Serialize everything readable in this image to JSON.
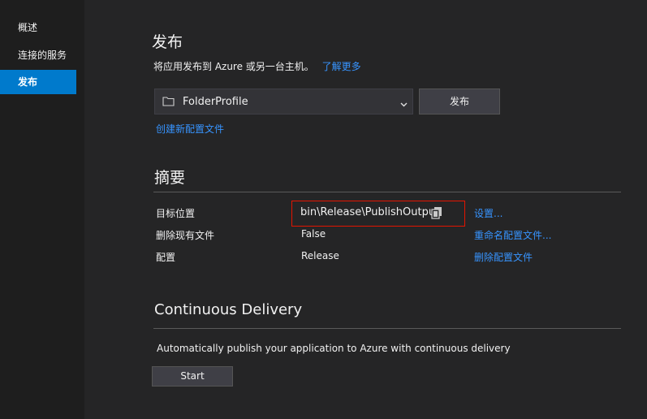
{
  "sidebar": {
    "items": [
      {
        "label": "概述"
      },
      {
        "label": "连接的服务"
      },
      {
        "label": "发布"
      }
    ]
  },
  "publish": {
    "title": "发布",
    "description": "将应用发布到 Azure 或另一台主机。",
    "learn_more": "了解更多",
    "profile_value": "FolderProfile",
    "publish_button": "发布",
    "create_profile": "创建新配置文件"
  },
  "summary": {
    "title": "摘要",
    "rows": [
      {
        "label": "目标位置",
        "value": "bin\\Release\\PublishOutput",
        "action": "设置..."
      },
      {
        "label": "删除现有文件",
        "value": "False",
        "action": "重命名配置文件..."
      },
      {
        "label": "配置",
        "value": "Release",
        "action": "删除配置文件"
      }
    ]
  },
  "cd": {
    "title": "Continuous Delivery",
    "description": "Automatically publish your application to Azure with continuous delivery",
    "start_button": "Start"
  },
  "icons": {
    "folder": "folder-icon",
    "chevron": "chevron-down-icon",
    "copy": "copy-icon"
  },
  "colors": {
    "accent": "#007acc",
    "link": "#3794ff",
    "highlight_border": "#e51400"
  }
}
